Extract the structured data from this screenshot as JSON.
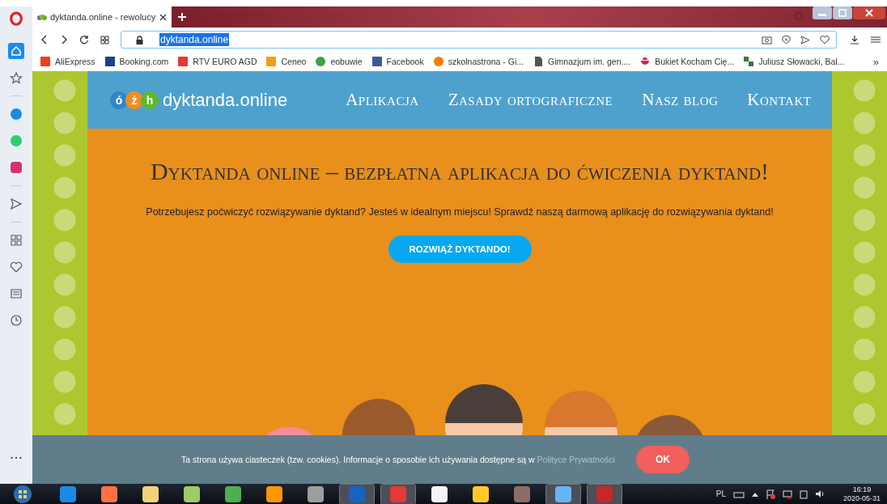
{
  "browser": {
    "tab": {
      "title": "dyktanda.online - rewolucy",
      "selected": true
    },
    "address": "dyktanda.online",
    "bookmarks": [
      {
        "label": "AliExpress",
        "kind": "bag"
      },
      {
        "label": "Booking.com",
        "kind": "square"
      },
      {
        "label": "RTV EURO AGD",
        "kind": "frame"
      },
      {
        "label": "Ceneo",
        "kind": "tile"
      },
      {
        "label": "eobuwie",
        "kind": "leaf"
      },
      {
        "label": "Facebook",
        "kind": "fb"
      },
      {
        "label": "szkolnastrona - Gi...",
        "kind": "smiley"
      },
      {
        "label": "Gimnazjum im. gen....",
        "kind": "document"
      },
      {
        "label": "Bukiet Kocham Cię...",
        "kind": "flower"
      },
      {
        "label": "Juliusz Słowacki, Bal...",
        "kind": "pinwheel"
      }
    ],
    "bookmarks_more": "»"
  },
  "sidebar": {
    "items": [
      {
        "kind": "home",
        "selected": true
      },
      {
        "kind": "star",
        "selected": false
      },
      {
        "kind": "messenger",
        "selected": false
      },
      {
        "kind": "whatsapp",
        "selected": false
      },
      {
        "kind": "instagram",
        "selected": false
      },
      {
        "kind": "send",
        "selected": false
      },
      {
        "kind": "grid",
        "selected": false
      },
      {
        "kind": "heart",
        "selected": false
      },
      {
        "kind": "news",
        "selected": false
      },
      {
        "kind": "clock",
        "selected": false
      }
    ]
  },
  "site": {
    "logo_letters": [
      "ó",
      "ż",
      "h"
    ],
    "logo_text": "dyktanda.online",
    "nav": [
      "Aplikacja",
      "Zasady ortograficzne",
      "Nasz blog",
      "Kontakt"
    ],
    "title": "Dyktanda online – bezpłatna aplikacja do ćwiczenia dyktand!",
    "intro": "Potrzebujesz poćwiczyć rozwiązywanie dyktand? Jesteś w idealnym miejscu! Sprawdź naszą darmową aplikację do rozwiązywania dyktand!",
    "cta": "ROZWIĄŻ DYKTANDO!"
  },
  "cookie_bar": {
    "text": "Ta strona używa ciasteczek (tzw. cookies). Informacje o sposobie ich używania dostępne są w",
    "link": "Polityce Prywatności",
    "button": "OK"
  },
  "taskbar": {
    "apps": [
      {
        "kind": "ie",
        "running": false
      },
      {
        "kind": "firefox",
        "running": false
      },
      {
        "kind": "folder",
        "running": false
      },
      {
        "kind": "map",
        "running": false
      },
      {
        "kind": "chrome",
        "running": false
      },
      {
        "kind": "player",
        "running": false
      },
      {
        "kind": "bird",
        "running": false
      },
      {
        "kind": "word",
        "running": true
      },
      {
        "kind": "opera",
        "running": true
      },
      {
        "kind": "blank",
        "running": false
      },
      {
        "kind": "palette",
        "running": false
      },
      {
        "kind": "book",
        "running": false
      },
      {
        "kind": "paint",
        "running": true
      },
      {
        "kind": "pdf",
        "running": true
      }
    ],
    "language": "PL",
    "time": "16:19",
    "date": "2020-05-31"
  }
}
